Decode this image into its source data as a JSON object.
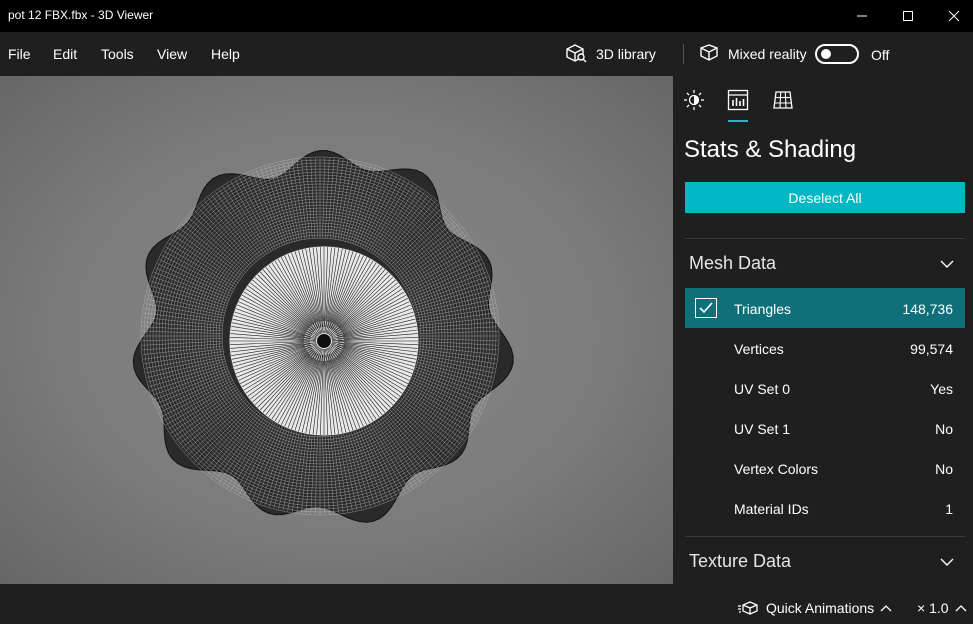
{
  "window": {
    "title": "pot 12 FBX.fbx - 3D Viewer"
  },
  "menu": {
    "items": [
      {
        "label": "File"
      },
      {
        "label": "Edit"
      },
      {
        "label": "Tools"
      },
      {
        "label": "View"
      },
      {
        "label": "Help"
      }
    ],
    "library_label": "3D library",
    "mixed_reality_label": "Mixed reality",
    "toggle_state": "Off"
  },
  "panel": {
    "tabs": [
      {
        "icon": "lighting-icon"
      },
      {
        "icon": "stats-icon",
        "active": true
      },
      {
        "icon": "grid-icon"
      }
    ],
    "title": "Stats & Shading",
    "deselect_label": "Deselect All",
    "mesh_section": {
      "label": "Mesh Data",
      "rows": [
        {
          "label": "Triangles",
          "value": "148,736",
          "checked": true
        },
        {
          "label": "Vertices",
          "value": "99,574"
        },
        {
          "label": "UV Set 0",
          "value": "Yes"
        },
        {
          "label": "UV Set 1",
          "value": "No"
        },
        {
          "label": "Vertex Colors",
          "value": "No"
        },
        {
          "label": "Material IDs",
          "value": "1"
        }
      ]
    },
    "texture_section": {
      "label": "Texture Data"
    }
  },
  "bottom": {
    "quick_animations_label": "Quick Animations",
    "speed_label": "× 1.0"
  },
  "colors": {
    "accent": "#00b7c3",
    "selected_row": "#10707a",
    "background": "#1f1f1f"
  }
}
